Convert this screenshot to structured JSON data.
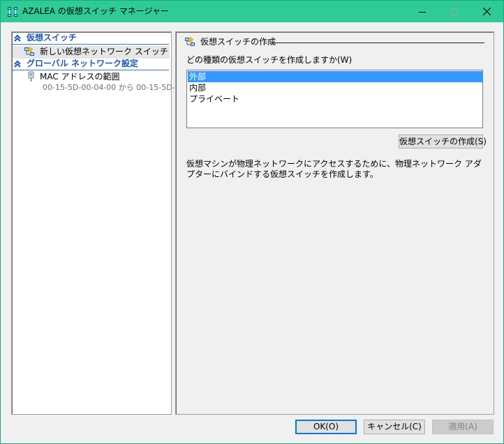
{
  "window": {
    "title": "AZALEA の仮想スイッチ マネージャー",
    "title_bar_color": "#2fcb95"
  },
  "sidebar": {
    "sections": [
      {
        "label": "仮想スイッチ",
        "icon": "double-chevron-up-icon",
        "items": [
          {
            "label": "新しい仮想ネットワーク スイッチ",
            "icon": "virtual-switch-icon",
            "selected": true
          }
        ]
      },
      {
        "label": "グローバル ネットワーク設定",
        "icon": "double-chevron-up-icon",
        "items": [
          {
            "label": "MAC アドレスの範囲",
            "sublabel": "00-15-5D-00-04-00 から 00-15-5D-...",
            "icon": "network-plug-icon"
          }
        ]
      }
    ]
  },
  "main": {
    "heading": "仮想スイッチの作成",
    "list_label": "どの種類の仮想スイッチを作成しますか(W)",
    "switch_types": [
      "外部",
      "内部",
      "プライベート"
    ],
    "selected_type": "外部",
    "create_button": "仮想スイッチの作成(S)",
    "description": "仮想マシンが物理ネットワークにアクセスするために、物理ネットワーク アダプターにバインドする仮想スイッチを作成します。"
  },
  "footer": {
    "ok": "OK(O)",
    "cancel": "キャンセル(C)",
    "apply": "適用(A)"
  },
  "colors": {
    "accent": "#3399ff",
    "section_header": "#1c56b3"
  }
}
